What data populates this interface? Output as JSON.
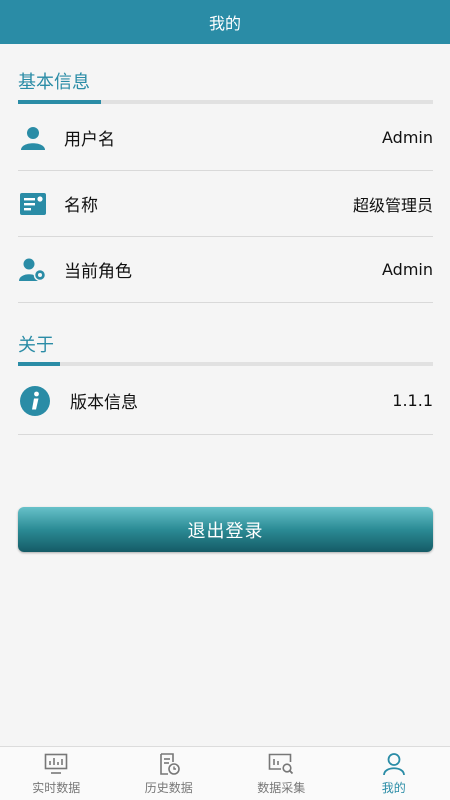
{
  "header": {
    "title": "我的"
  },
  "sections": [
    {
      "title": "基本信息"
    },
    {
      "title": "关于"
    }
  ],
  "basic_info": [
    {
      "label": "用户名",
      "value": "Admin",
      "icon": "user-icon"
    },
    {
      "label": "名称",
      "value": "超级管理员",
      "icon": "id-card-icon"
    },
    {
      "label": "当前角色",
      "value": "Admin",
      "icon": "user-gear-icon"
    }
  ],
  "about": [
    {
      "label": "版本信息",
      "value": "1.1.1",
      "icon": "info-icon"
    }
  ],
  "logout": {
    "label": "退出登录"
  },
  "tabs": [
    {
      "label": "实时数据",
      "icon": "monitor-chart-icon"
    },
    {
      "label": "历史数据",
      "icon": "history-doc-icon"
    },
    {
      "label": "数据采集",
      "icon": "data-search-icon"
    },
    {
      "label": "我的",
      "icon": "person-icon"
    }
  ],
  "colors": {
    "accent": "#2a8ca6",
    "background": "#f5f5f5"
  }
}
